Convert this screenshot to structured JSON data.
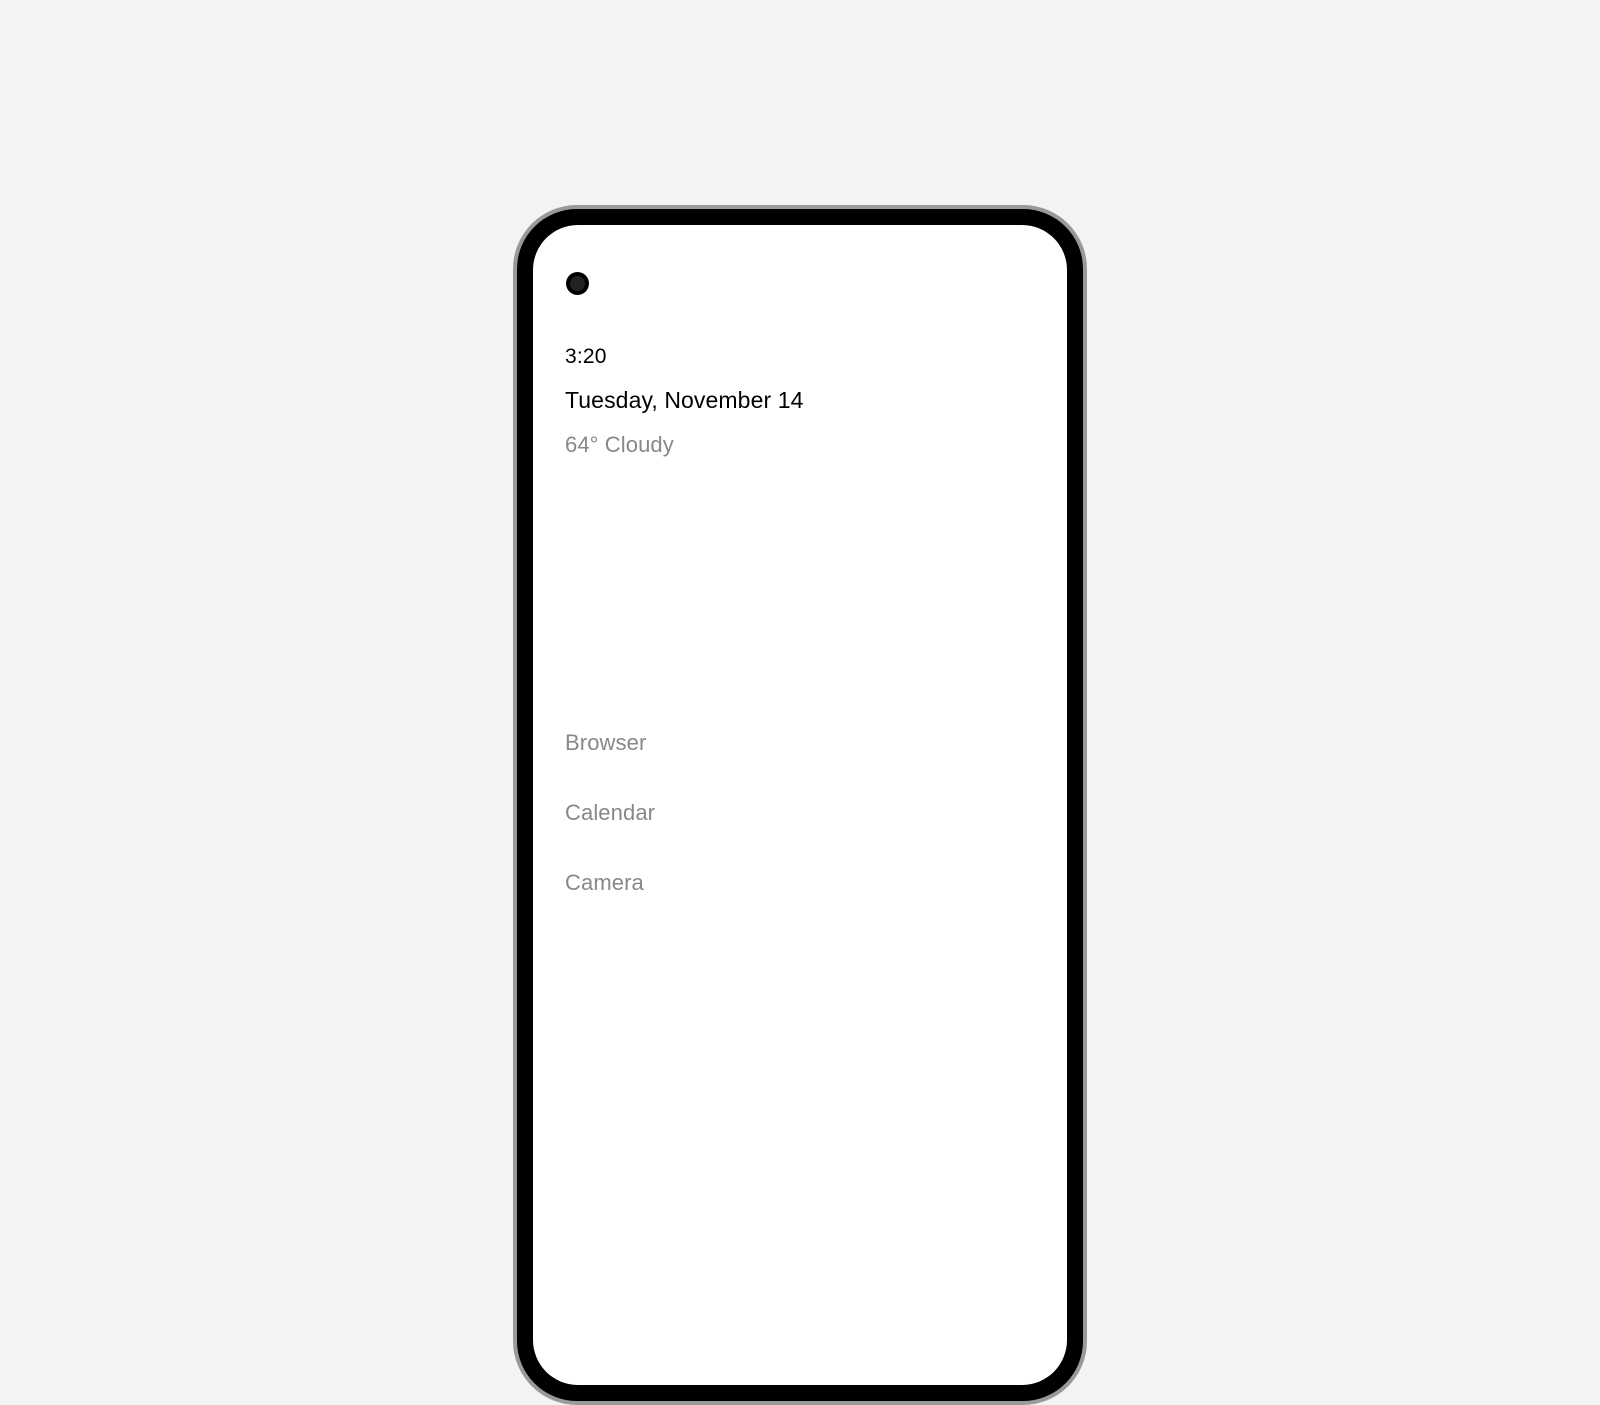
{
  "status": {
    "time": "3:20",
    "date": "Tuesday, November 14",
    "weather": "64° Cloudy"
  },
  "apps": [
    {
      "label": "Browser"
    },
    {
      "label": "Calendar"
    },
    {
      "label": "Camera"
    }
  ]
}
